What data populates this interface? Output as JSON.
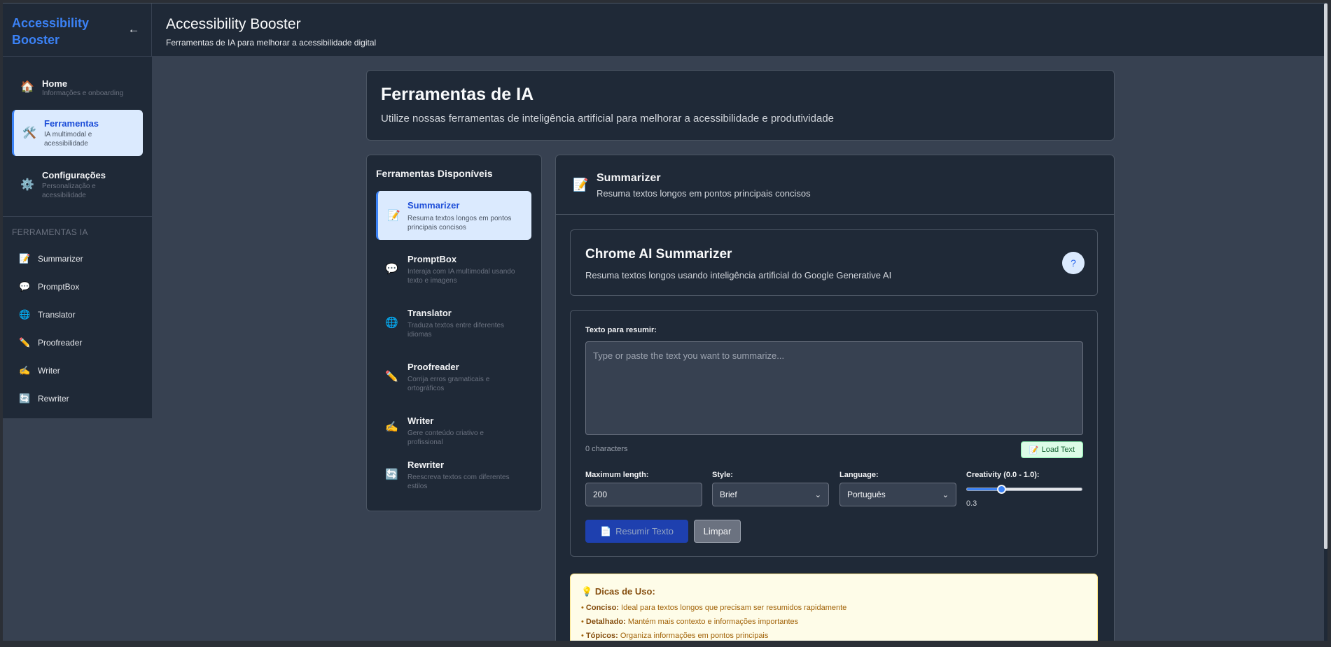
{
  "app": {
    "brand": "Accessibility Booster",
    "collapse_icon": "←",
    "header_title": "Accessibility Booster",
    "header_subtitle": "Ferramentas de IA para melhorar a acessibilidade digital"
  },
  "sidebar": {
    "nav": [
      {
        "icon": "🏠",
        "title": "Home",
        "subtitle": "Informações e onboarding"
      },
      {
        "icon": "🛠️",
        "title": "Ferramentas",
        "subtitle": "IA multimodal e acessibilidade"
      },
      {
        "icon": "⚙️",
        "title": "Configurações",
        "subtitle": "Personalização e acessibilidade"
      }
    ],
    "section_title": "FERRAMENTAS IA",
    "tools": [
      {
        "icon": "📝",
        "label": "Summarizer"
      },
      {
        "icon": "💬",
        "label": "PromptBox"
      },
      {
        "icon": "🌐",
        "label": "Translator"
      },
      {
        "icon": "✏️",
        "label": "Proofreader"
      },
      {
        "icon": "✍️",
        "label": "Writer"
      },
      {
        "icon": "🔄",
        "label": "Rewriter"
      }
    ]
  },
  "hero": {
    "title": "Ferramentas de IA",
    "subtitle": "Utilize nossas ferramentas de inteligência artificial para melhorar a acessibilidade e produtividade"
  },
  "tools_panel": {
    "heading": "Ferramentas Disponíveis",
    "items": [
      {
        "icon": "📝",
        "title": "Summarizer",
        "subtitle": "Resuma textos longos em pontos principais concisos"
      },
      {
        "icon": "💬",
        "title": "PromptBox",
        "subtitle": "Interaja com IA multimodal usando texto e imagens"
      },
      {
        "icon": "🌐",
        "title": "Translator",
        "subtitle": "Traduza textos entre diferentes idiomas"
      },
      {
        "icon": "✏️",
        "title": "Proofreader",
        "subtitle": "Corrija erros gramaticais e ortográficos"
      },
      {
        "icon": "✍️",
        "title": "Writer",
        "subtitle": "Gere conteúdo criativo e profissional"
      },
      {
        "icon": "🔄",
        "title": "Rewriter",
        "subtitle": "Reescreva textos com diferentes estilos"
      }
    ]
  },
  "panel": {
    "icon": "📝",
    "title": "Summarizer",
    "subtitle": "Resuma textos longos em pontos principais concisos",
    "card_title": "Chrome AI Summarizer",
    "card_subtitle": "Resuma textos longos usando inteligência artificial do Google Generative AI",
    "help_icon": "?"
  },
  "form": {
    "text_label": "Texto para resumir:",
    "text_value": "",
    "text_placeholder": "Type or paste the text you want to summarize...",
    "char_count": "0 characters",
    "load_button": "Load Text",
    "load_icon": "📝",
    "max_length_label": "Maximum length:",
    "max_length_value": "200",
    "style_label": "Style:",
    "style_value": "Brief",
    "language_label": "Language:",
    "language_value": "Português",
    "creativity_label": "Creativity (0.0 - 1.0):",
    "creativity_value": 0.3,
    "creativity_display": "0.3",
    "submit_button": "Resumir Texto",
    "submit_icon": "📄",
    "clear_button": "Limpar"
  },
  "tips": {
    "icon": "💡",
    "title": "Dicas de Uso:",
    "items": [
      {
        "term": "Conciso:",
        "text": "Ideal para textos longos que precisam ser resumidos rapidamente"
      },
      {
        "term": "Detalhado:",
        "text": "Mantém mais contexto e informações importantes"
      },
      {
        "term": "Tópicos:",
        "text": "Organiza informações em pontos principais"
      }
    ]
  },
  "colors": {
    "accent": "#3b82f6",
    "background": "#374151",
    "surface": "#1f2937",
    "active_bg": "#dbeafe",
    "tips_bg": "#fefce8"
  }
}
